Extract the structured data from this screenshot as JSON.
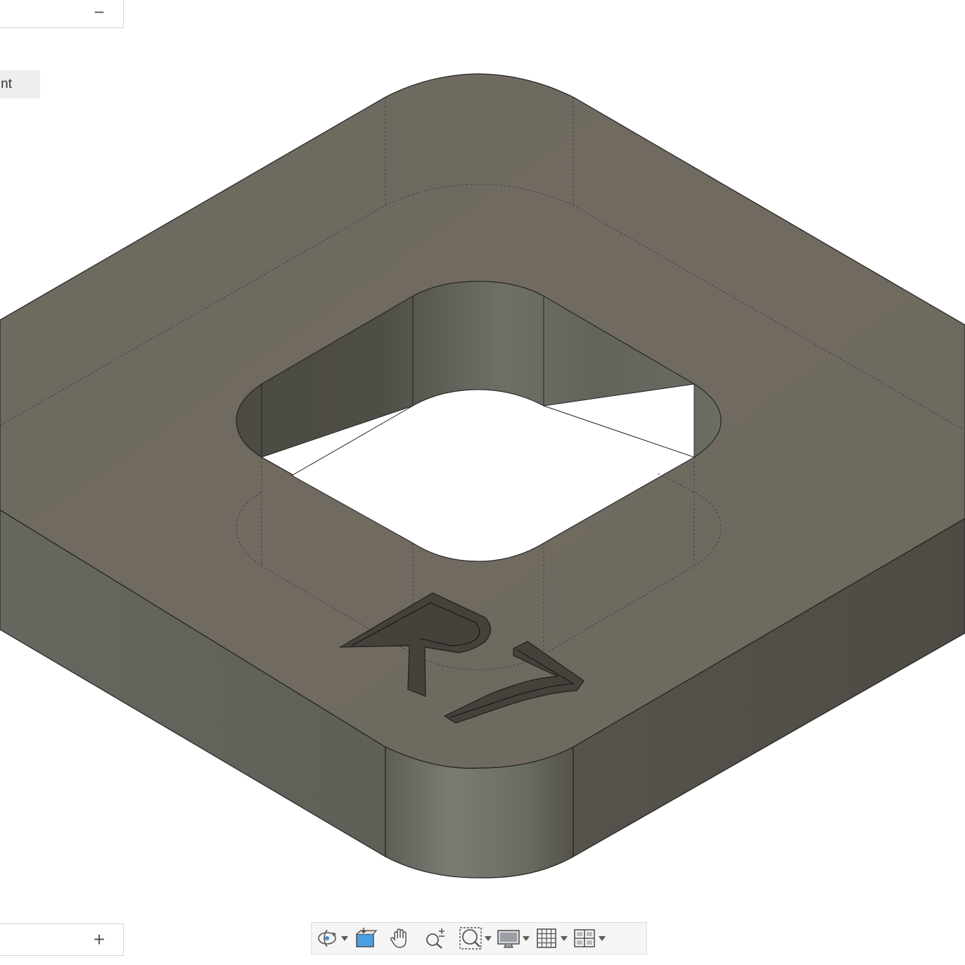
{
  "top_panel": {
    "collapse_label": "−"
  },
  "side_label": {
    "text": "nt"
  },
  "bottom_panel": {
    "expand_label": "+"
  },
  "model": {
    "engraving": "R7",
    "body_color": "#6b665c"
  },
  "toolbar": {
    "tools": [
      {
        "name": "orbit",
        "icon": "orbit-icon",
        "has_menu": true
      },
      {
        "name": "look-at",
        "icon": "look-at-icon",
        "has_menu": false
      },
      {
        "name": "pan",
        "icon": "pan-hand-icon",
        "has_menu": false
      },
      {
        "name": "zoom",
        "icon": "zoom-icon",
        "has_menu": false
      },
      {
        "name": "fit",
        "icon": "fit-window-icon",
        "has_menu": true
      },
      {
        "name": "display-settings",
        "icon": "display-monitor-icon",
        "has_menu": true
      },
      {
        "name": "grid-and-snaps",
        "icon": "grid-icon",
        "has_menu": true
      },
      {
        "name": "viewports",
        "icon": "viewports-icon",
        "has_menu": true
      }
    ]
  }
}
